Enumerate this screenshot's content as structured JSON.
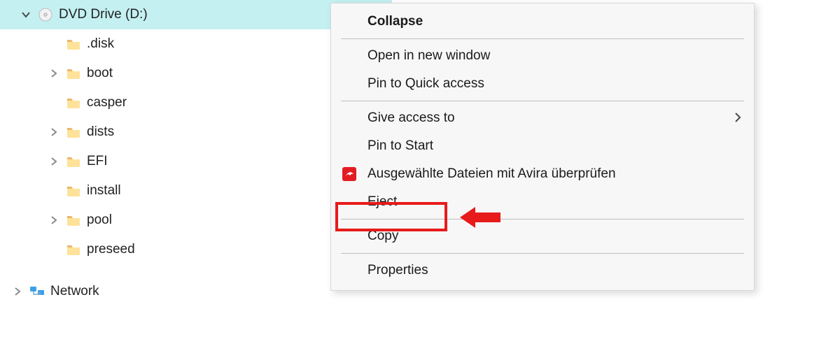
{
  "tree": {
    "drive": {
      "label": "DVD Drive (D:)"
    },
    "children": [
      {
        "label": ".disk",
        "expandable": false
      },
      {
        "label": "boot",
        "expandable": true
      },
      {
        "label": "casper",
        "expandable": false
      },
      {
        "label": "dists",
        "expandable": true
      },
      {
        "label": "EFI",
        "expandable": true
      },
      {
        "label": "install",
        "expandable": false
      },
      {
        "label": "pool",
        "expandable": true
      },
      {
        "label": "preseed",
        "expandable": false
      }
    ],
    "network": {
      "label": "Network"
    }
  },
  "menu": {
    "collapse": "Collapse",
    "open_new_window": "Open in new window",
    "pin_quick_access": "Pin to Quick access",
    "give_access_to": "Give access to",
    "pin_to_start": "Pin to Start",
    "avira_scan": "Ausgewählte Dateien mit Avira überprüfen",
    "eject": "Eject",
    "copy": "Copy",
    "properties": "Properties"
  },
  "annotation": {
    "highlight_target": "eject"
  },
  "colors": {
    "selection": "#c4f0f2",
    "folder": "#ffe29a",
    "folder_tab": "#e8b86d",
    "avira": "#e31b23",
    "red_annotation": "#e81b1b"
  }
}
